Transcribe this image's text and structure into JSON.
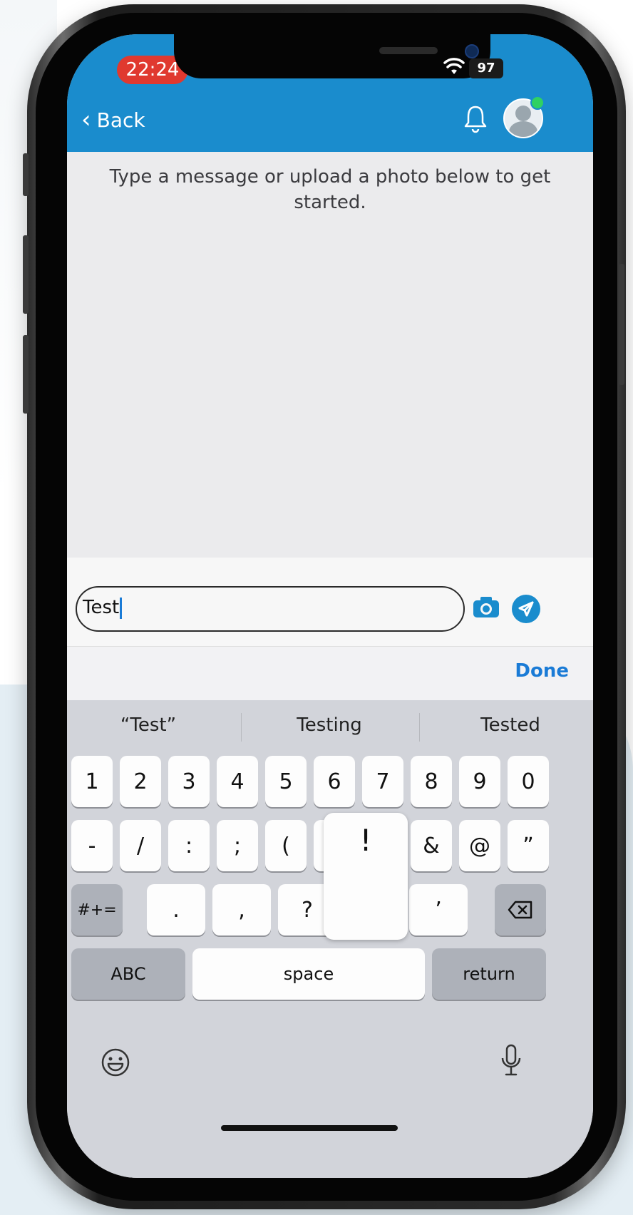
{
  "status_bar": {
    "time": "22:24",
    "battery": "97"
  },
  "nav": {
    "back_label": "Back"
  },
  "content": {
    "empty_message": "Type a message or upload a photo below to get started."
  },
  "composer": {
    "value": "Test"
  },
  "toolbar": {
    "done_label": "Done"
  },
  "keyboard": {
    "suggestions": [
      "“Test”",
      "Testing",
      "Tested"
    ],
    "row1": [
      "1",
      "2",
      "3",
      "4",
      "5",
      "6",
      "7",
      "8",
      "9",
      "0"
    ],
    "row2": [
      "-",
      "/",
      ":",
      ";",
      "(",
      "&",
      "@",
      "”"
    ],
    "row3": [
      "#+=",
      ".",
      ",",
      "?",
      "’"
    ],
    "popup_key": "!",
    "abc_label": "ABC",
    "space_label": "space",
    "return_label": "return"
  },
  "colors": {
    "accent": "#1a8ccd",
    "status_pill": "#e0392f"
  }
}
